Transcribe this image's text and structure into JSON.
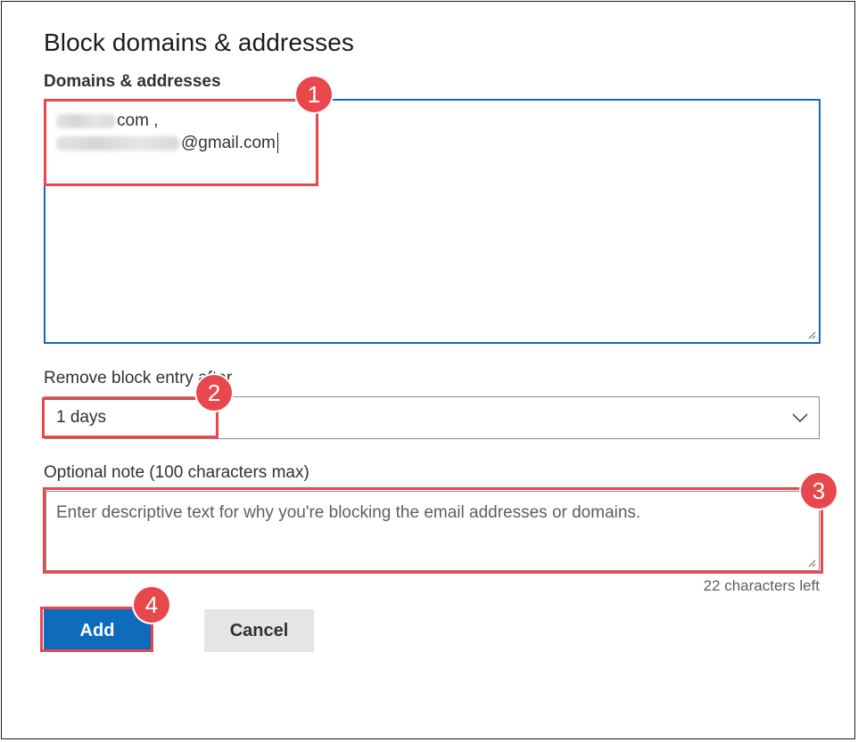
{
  "dialog": {
    "title": "Block domains & addresses"
  },
  "domains_field": {
    "label": "Domains & addresses",
    "entries": [
      "com ,",
      "@gmail.com"
    ]
  },
  "expiry_field": {
    "label": "Remove block entry after",
    "selected": "1 days"
  },
  "note_field": {
    "label": "Optional note (100 characters max)",
    "placeholder": "Enter descriptive text for why you're blocking the email addresses or domains.",
    "chars_left": "22 characters left"
  },
  "actions": {
    "add_label": "Add",
    "cancel_label": "Cancel"
  },
  "callouts": [
    "1",
    "2",
    "3",
    "4"
  ],
  "colors": {
    "accent": "#0f6cbd",
    "callout": "#e8484c"
  },
  "icons": {
    "select": "chevron-down-icon",
    "resize": "resize-grip-icon"
  }
}
